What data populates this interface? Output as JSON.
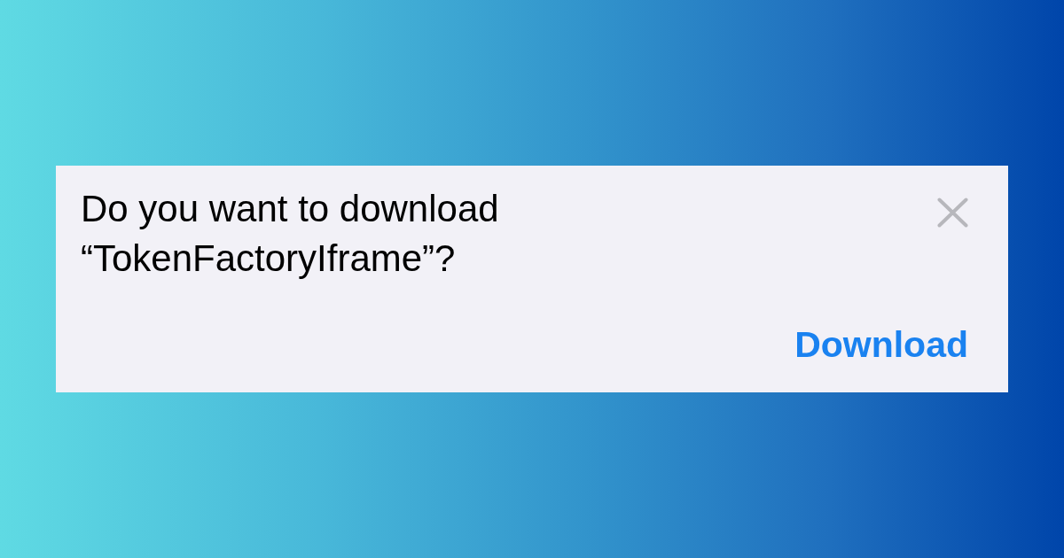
{
  "dialog": {
    "message": "Do you want to download “TokenFactoryIframe”?",
    "primary_action": "Download"
  }
}
